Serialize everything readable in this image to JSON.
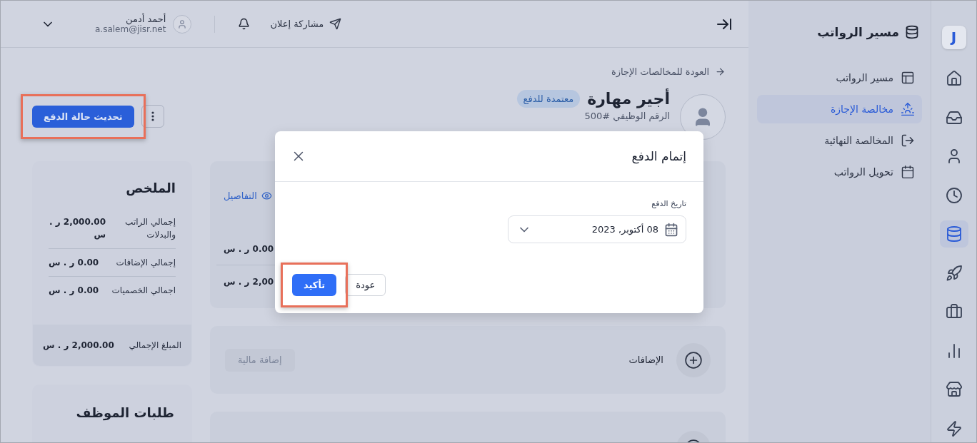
{
  "rail": {
    "logo": "J",
    "items": [
      {
        "selected": false
      },
      {
        "selected": false
      },
      {
        "selected": false
      },
      {
        "selected": false
      },
      {
        "selected": true
      },
      {
        "selected": false
      },
      {
        "selected": false
      },
      {
        "selected": false
      },
      {
        "selected": false
      },
      {
        "selected": false
      }
    ]
  },
  "sidebar": {
    "title": "مسير الرواتب",
    "items": [
      {
        "label": "مسير الرواتب",
        "selected": false
      },
      {
        "label": "مخالصة الإجازة",
        "selected": true
      },
      {
        "label": "المخالصة النهائية",
        "selected": false
      },
      {
        "label": "تحويل الرواتب",
        "selected": false
      }
    ]
  },
  "header": {
    "share": "مشاركة إعلان",
    "user": {
      "name": "أحمد أدمن",
      "email": "a.salem@jisr.net"
    }
  },
  "page": {
    "back_link": "العودة للمخالصات الإجازة",
    "employee": {
      "name": "أجير مهارة",
      "status": "معتمدة للدفع",
      "id": "الرقم الوظيفي #500"
    },
    "primary_action": {
      "label": "تحديث حالة الدفع",
      "highlighted": true
    }
  },
  "details_card": {
    "link": "التفاصيل",
    "rows": [
      {
        "value": "0.00 ر . س"
      },
      {
        "value": "2,00 ر . س"
      }
    ]
  },
  "sections": [
    {
      "title": "الإضافات",
      "button": {
        "label": "إضافة مالية",
        "disabled": true
      }
    }
  ],
  "summary": {
    "title": "الملخص",
    "rows": [
      {
        "label": "إجمالي الراتب والبدلات",
        "value": "2,000.00 ر . س"
      },
      {
        "label": "إجمالي الإضافات",
        "value": "0.00 ر . س"
      },
      {
        "label": "اجمالي الخصميات",
        "value": "0.00 ر . س"
      }
    ],
    "total": {
      "label": "المبلغ الإجمالي",
      "value": "2,000.00 ر . س"
    }
  },
  "requests": {
    "title": "طلبات الموظف"
  },
  "modal": {
    "title": "إتمام الدفع",
    "date_label": "تاريخ الدفع",
    "date_value": "08 أكتوبر, 2023",
    "back": "عودة",
    "confirm": {
      "label": "تأكيد",
      "highlighted": true
    }
  }
}
